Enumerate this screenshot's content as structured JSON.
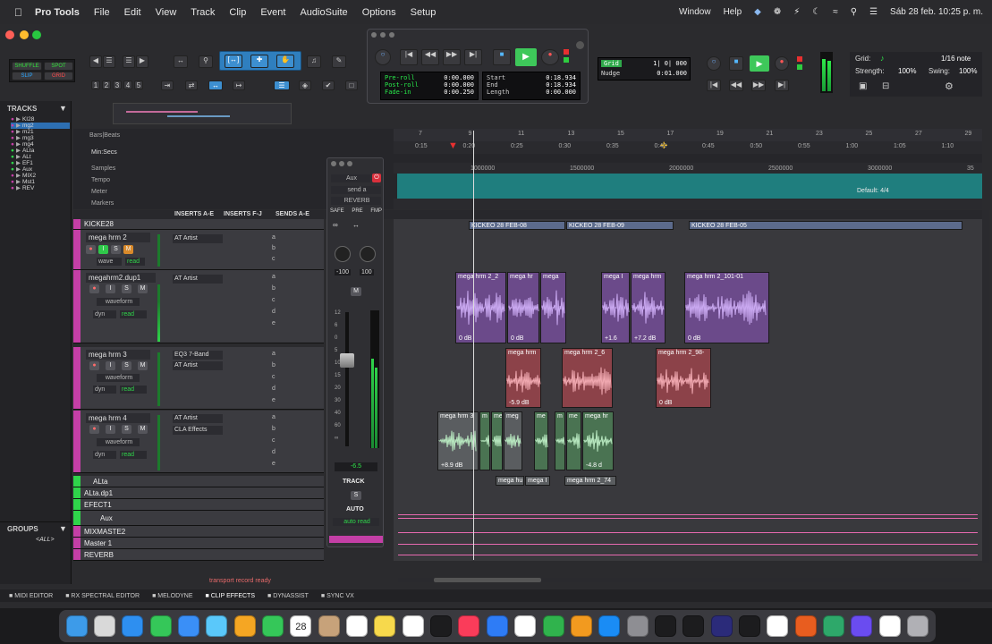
{
  "menubar": {
    "app_name": "Pro Tools",
    "items": [
      "File",
      "Edit",
      "View",
      "Track",
      "Clip",
      "Event",
      "AudioSuite",
      "Options",
      "Setup"
    ],
    "right_items": [
      "Window",
      "Help"
    ],
    "clock": "Sáb 28 feb.  10:25 p. m."
  },
  "toolbar": {
    "edit_modes": [
      "SHUFFLE",
      "SPOT",
      "SLIP",
      "GRID"
    ],
    "zoom_presets": [
      "1",
      "2",
      "3",
      "4",
      "5"
    ]
  },
  "transport": {
    "preroll_label": "Pre-roll",
    "postroll_label": "Post-roll",
    "fadein_label": "Fade-in",
    "preroll": "0:00.000",
    "postroll": "0:00.000",
    "fadein": "0:00.250",
    "start_label": "Start",
    "end_label": "End",
    "length_label": "Length",
    "start": "0:18.934",
    "end": "0:18.934",
    "length": "0:00.000"
  },
  "grid": {
    "grid_label": "Grid",
    "grid_value": "1| 0| 000",
    "nudge_label": "Nudge",
    "nudge_value": "0:01.000",
    "grid_right_label": "Grid:",
    "note_value": "1/16 note",
    "strength_label": "Strength:",
    "strength_value": "100%",
    "swing_label": "Swing:",
    "swing_value": "100%"
  },
  "tracks_panel": {
    "title": "TRACKS",
    "items": [
      "KI28",
      "mg2",
      "m21",
      "mg3",
      "mg4",
      "ALta",
      "ALt",
      "EF1",
      "Aux",
      "MIX2",
      "Mst1",
      "REV"
    ],
    "groups_title": "GROUPS",
    "groups_all": "<ALL>"
  },
  "rulers": {
    "labels": [
      "Bars|Beats",
      "Min:Secs",
      "Samples",
      "Tempo",
      "Meter",
      "Markers"
    ],
    "bars": [
      "7",
      "9",
      "11",
      "13",
      "15",
      "17",
      "19",
      "21",
      "23",
      "25",
      "27",
      "29"
    ],
    "minsecs": [
      "0:15",
      "0:20",
      "0:25",
      "0:30",
      "0:35",
      "0:40",
      "0:45",
      "0:50",
      "0:55",
      "1:00",
      "1:05",
      "1:10"
    ],
    "samples": [
      "1000000",
      "1500000",
      "2000000",
      "2500000",
      "3000000",
      "35"
    ],
    "meter_text": "Default: 4/4"
  },
  "column_headers": [
    "INSERTS A-E",
    "INSERTS F-J",
    "SENDS A-E"
  ],
  "tracks": [
    {
      "name": "KICKE28",
      "inserts": []
    },
    {
      "name": "mega hrm 2",
      "inserts": [
        "AT Artist"
      ],
      "playlist": "wave",
      "auto": "read"
    },
    {
      "name": "megahrm2.dup1",
      "inserts": [
        "AT Artist"
      ],
      "playlist": "waveform",
      "auto": "read",
      "dyn": "dyn"
    },
    {
      "name": "mega hrm 3",
      "inserts": [
        "EQ3 7-Band",
        "AT Artist"
      ],
      "playlist": "waveform",
      "auto": "read",
      "dyn": "dyn"
    },
    {
      "name": "mega hrm 4",
      "inserts": [
        "AT Artist",
        "CLA Effects"
      ],
      "playlist": "waveform",
      "auto": "read",
      "dyn": "dyn"
    },
    {
      "name": "ALta"
    },
    {
      "name": "ALta.dp1"
    },
    {
      "name": "EFECT1"
    },
    {
      "name": "Aux"
    },
    {
      "name": "MIXMASTE2"
    },
    {
      "name": "Master 1"
    },
    {
      "name": "REVERB"
    }
  ],
  "send_slots": [
    "a",
    "b",
    "c",
    "d",
    "e"
  ],
  "mixer_strip": {
    "io_label": "Aux",
    "send_label": "send a",
    "send_dest": "REVERB",
    "buttons": [
      "SAFE",
      "PRE",
      "FMP"
    ],
    "pan_left": "-100",
    "pan_right": "100",
    "mute": "M",
    "fader_value": "-6.5",
    "track_label": "TRACK",
    "auto_label": "AUTO",
    "auto_mode": "auto read"
  },
  "clips": {
    "kick": [
      "KICKEO 28 FEB-08",
      "KICKEO 28 FEB-09",
      "KICKEO 28 FEB-05"
    ],
    "track2": [
      {
        "name": "mega hrm 2_2",
        "db": "0 dB"
      },
      {
        "name": "mega hr",
        "db": "0 dB"
      },
      {
        "name": "mega",
        "db": ""
      },
      {
        "name": "mega I",
        "db": "+1.6"
      },
      {
        "name": "mega hrm",
        "db": "+7.2 dB"
      },
      {
        "name": "mega hrm 2_101-01",
        "db": "0 dB"
      }
    ],
    "track3": [
      {
        "name": "mega hrm",
        "db": "-5.9 dB"
      },
      {
        "name": "mega hrm 2_6",
        "db": ""
      },
      {
        "name": "mega hrm 2_98-",
        "db": "0 dB"
      }
    ],
    "track4": [
      {
        "name": "mega hrm 3",
        "db": "+8.9 dB"
      },
      {
        "name": "m",
        "db": ""
      },
      {
        "name": "me",
        "db": ""
      },
      {
        "name": "meg",
        "db": ""
      },
      {
        "name": "me",
        "db": ""
      },
      {
        "name": "m",
        "db": ""
      },
      {
        "name": "me",
        "db": ""
      },
      {
        "name": "mega hr",
        "db": "-4.8 d"
      }
    ],
    "track4_below": [
      "mega hu",
      "mega I",
      "mega hrm 2_74"
    ]
  },
  "status": {
    "message": "transport record ready"
  },
  "bottom_tabs": [
    "MIDI EDITOR",
    "RX SPECTRAL EDITOR",
    "MELODYNE",
    "CLIP EFFECTS",
    "DYNASSIST",
    "SYNC VX"
  ],
  "dock": {
    "calendar_day": "28",
    "icons": [
      "finder-icon",
      "launchpad-icon",
      "safari-icon",
      "messages-icon",
      "mail-icon",
      "maps-icon",
      "photos-icon",
      "facetime-icon",
      "calendar-icon",
      "contacts-icon",
      "reminders-icon",
      "notes-icon",
      "freeform-icon",
      "tv-icon",
      "music-icon",
      "keynote-icon",
      "tips-icon",
      "numbers-icon",
      "pages-icon",
      "appstore-icon",
      "settings-icon",
      "protools-icon",
      "avid-icon",
      "izotope-icon",
      "logic-icon",
      "capcut-icon",
      "app-icon",
      "app-icon-2",
      "app-icon-3",
      "document-icon",
      "trash-icon"
    ]
  }
}
